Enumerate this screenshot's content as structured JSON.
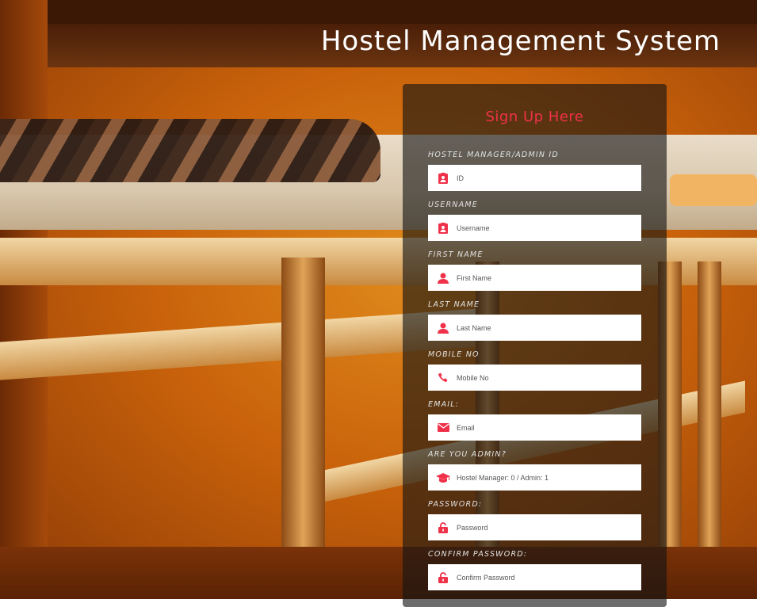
{
  "page": {
    "title": "Hostel Management System",
    "accent_color": "#f0314a"
  },
  "form": {
    "heading": "Sign Up Here",
    "fields": [
      {
        "label": "HOSTEL MANAGER/ADMIN ID",
        "placeholder": "ID",
        "icon": "id-card-icon"
      },
      {
        "label": "USERNAME",
        "placeholder": "Username",
        "icon": "id-card-icon"
      },
      {
        "label": "FIRST NAME",
        "placeholder": "First Name",
        "icon": "user-icon"
      },
      {
        "label": "LAST NAME",
        "placeholder": "Last Name",
        "icon": "user-icon"
      },
      {
        "label": "MOBILE NO",
        "placeholder": "Mobile No",
        "icon": "phone-icon"
      },
      {
        "label": "EMAIL:",
        "placeholder": "Email",
        "icon": "envelope-icon"
      },
      {
        "label": "ARE YOU ADMIN?",
        "placeholder": "Hostel Manager: 0 / Admin: 1",
        "icon": "graduation-cap-icon"
      },
      {
        "label": "PASSWORD:",
        "placeholder": "Password",
        "icon": "unlock-icon"
      },
      {
        "label": "CONFIRM PASSWORD:",
        "placeholder": "Confirm Password",
        "icon": "unlock-icon"
      }
    ]
  }
}
